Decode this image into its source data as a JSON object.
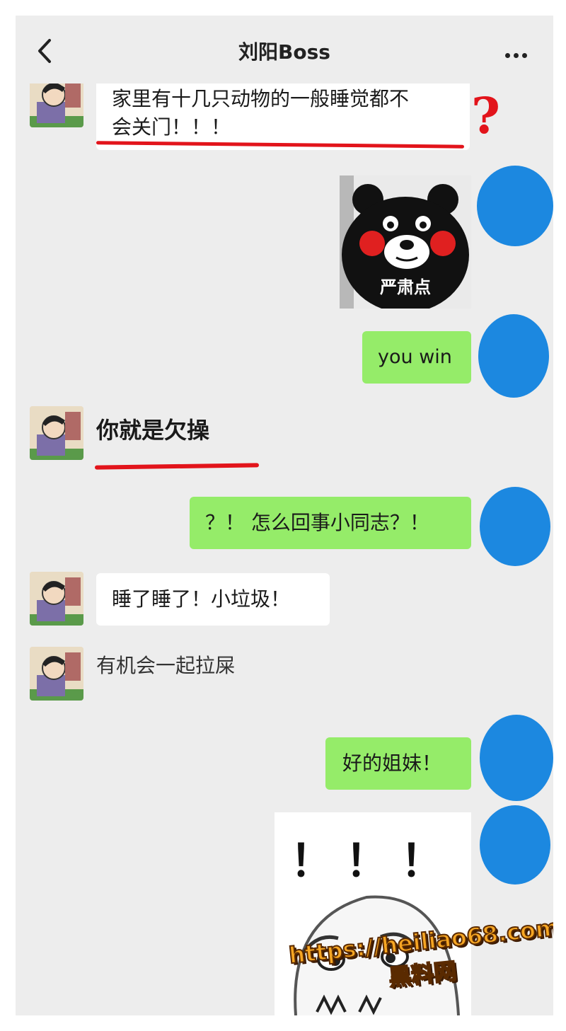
{
  "header": {
    "title": "刘阳Boss"
  },
  "messages": {
    "m1": {
      "text_line1": "家里有十几只动物的一般睡觉都不",
      "text_line2": "会关门！！！",
      "annotation": "?"
    },
    "m2": {
      "sticker_caption": "严肃点"
    },
    "m3": {
      "text": "you win"
    },
    "m4": {
      "text": "你就是欠操"
    },
    "m5": {
      "text": "？！ 怎么回事小同志？！"
    },
    "m6": {
      "text": "睡了睡了！小垃圾！"
    },
    "m7": {
      "text": "有机会一起拉屎"
    },
    "m8": {
      "text": "好的姐妹！"
    },
    "m9": {
      "sticker_text": "！！！"
    }
  },
  "watermark": {
    "url": "https://heiliao68.com",
    "name": "黑料网"
  },
  "colors": {
    "background": "#ededed",
    "outgoing_bubble": "#95ec69",
    "incoming_bubble": "#ffffff",
    "annotation_red": "#e2141b",
    "censor_blue": "#1c88e0"
  }
}
